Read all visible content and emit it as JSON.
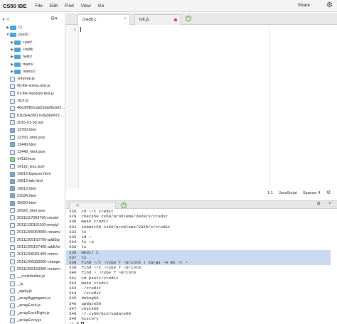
{
  "app": {
    "name": "CS50 IDE"
  },
  "menu": [
    "File",
    "Edit",
    "Find",
    "View",
    "Go"
  ],
  "share_label": "Share",
  "tree": {
    "root": "~/",
    "items": [
      {
        "label": "C/",
        "kind": "folder",
        "depth": 1,
        "caret": "▶"
      },
      {
        "label": "pset1/",
        "kind": "folder",
        "depth": 1,
        "caret": "▼"
      },
      {
        "label": "cash/",
        "kind": "folder",
        "depth": 2,
        "caret": "▶"
      },
      {
        "label": "credit/",
        "kind": "folder",
        "depth": 2,
        "caret": "▶"
      },
      {
        "label": "hello/",
        "kind": "folder",
        "depth": 2,
        "caret": "▶"
      },
      {
        "label": "mario/",
        "kind": "folder",
        "depth": 2,
        "caret": "▶"
      },
      {
        "label": "mario2/",
        "kind": "folder",
        "depth": 2,
        "caret": "▶"
      },
      {
        "label": "-internal.js",
        "kind": "file",
        "depth": 1,
        "caret": ""
      },
      {
        "label": "00-file-stress.test.js",
        "kind": "file",
        "depth": 1,
        "caret": ""
      },
      {
        "label": "01-file-maxsize.test.js",
        "kind": "file",
        "depth": 1,
        "caret": ""
      },
      {
        "label": "1to2.js",
        "kind": "file",
        "depth": 1,
        "caret": ""
      },
      {
        "label": "46e3f6f52cda23da06cb02…",
        "kind": "file",
        "depth": 1,
        "caret": ""
      },
      {
        "label": "61b3e429917e8a5b8472…",
        "kind": "file",
        "depth": 1,
        "caret": ""
      },
      {
        "label": "2015-01-30.md",
        "kind": "file",
        "depth": 1,
        "caret": ""
      },
      {
        "label": "12750.html",
        "kind": "img",
        "depth": 1,
        "caret": ""
      },
      {
        "label": "12750_html.json",
        "kind": "file",
        "depth": 1,
        "caret": ""
      },
      {
        "label": "13448.html",
        "kind": "img",
        "depth": 1,
        "caret": ""
      },
      {
        "label": "13448_html.json",
        "kind": "file",
        "depth": 1,
        "caret": ""
      },
      {
        "label": "14119.less",
        "kind": "less",
        "depth": 1,
        "caret": ""
      },
      {
        "label": "14119_less.json",
        "kind": "file",
        "depth": 1,
        "caret": ""
      },
      {
        "label": "19813-fspaces.html",
        "kind": "img",
        "depth": 1,
        "caret": ""
      },
      {
        "label": "19813-tab.html",
        "kind": "img",
        "depth": 1,
        "caret": ""
      },
      {
        "label": "19813.html",
        "kind": "img",
        "depth": 1,
        "caret": ""
      },
      {
        "label": "21634.html",
        "kind": "img",
        "depth": 1,
        "caret": ""
      },
      {
        "label": "25920.html",
        "kind": "img",
        "depth": 1,
        "caret": ""
      },
      {
        "label": "25920_html.json",
        "kind": "file",
        "depth": 1,
        "caret": ""
      },
      {
        "label": "20111117063700-createl",
        "kind": "file",
        "depth": 1,
        "caret": ""
      },
      {
        "label": "20111130161100-emptyf",
        "kind": "file",
        "depth": 1,
        "caret": ""
      },
      {
        "label": "20111205064000-renamv",
        "kind": "file",
        "depth": 1,
        "caret": ""
      },
      {
        "label": "20111205162700-addSig",
        "kind": "file",
        "depth": 1,
        "caret": ""
      },
      {
        "label": "20111205167400-addUni",
        "kind": "file",
        "depth": 1,
        "caret": ""
      },
      {
        "label": "20111206061400-remov",
        "kind": "file",
        "depth": 1,
        "caret": ""
      },
      {
        "label": "20111206063000-change",
        "kind": "file",
        "depth": 1,
        "caret": ""
      },
      {
        "label": "20111206163300-renamv",
        "kind": "file",
        "depth": 1,
        "caret": ""
      },
      {
        "label": "__contribution.js",
        "kind": "file",
        "depth": 1,
        "caret": ""
      },
      {
        "label": "_.js",
        "kind": "file",
        "depth": 1,
        "caret": ""
      },
      {
        "label": "_apply.js",
        "kind": "file",
        "depth": 1,
        "caret": ""
      },
      {
        "label": "_arrayAggregator.js",
        "kind": "file",
        "depth": 1,
        "caret": ""
      },
      {
        "label": "_arrayEach.js",
        "kind": "file",
        "depth": 1,
        "caret": ""
      },
      {
        "label": "_arrayEachRight.js",
        "kind": "file",
        "depth": 1,
        "caret": ""
      },
      {
        "label": "_arrayEvery.js",
        "kind": "file",
        "depth": 1,
        "caret": ""
      }
    ]
  },
  "editor": {
    "tabs": [
      {
        "label": "credit.c",
        "active": true,
        "modified": false
      },
      {
        "label": "init.js",
        "active": false,
        "modified": true
      }
    ],
    "line_number": "1"
  },
  "status": {
    "position": "1:1",
    "language": "JavaScript",
    "spaces": "Spaces: 4"
  },
  "terminal": {
    "tab_label": "~/",
    "lines": [
      {
        "num": "328",
        "cmd": "cd ~/C credit",
        "hl": false
      },
      {
        "num": "329",
        "cmd": "check50 cs50/problems/2020/x/credit",
        "hl": false
      },
      {
        "num": "330",
        "cmd": "make credit",
        "hl": false
      },
      {
        "num": "331",
        "cmd": "submit50 cs50/problems/2020/x/credit",
        "hl": false
      },
      {
        "num": "332",
        "cmd": "ls",
        "hl": false
      },
      {
        "num": "333",
        "cmd": "cd ~",
        "hl": false
      },
      {
        "num": "334",
        "cmd": "ls ~a",
        "hl": false
      },
      {
        "num": "335",
        "cmd": "ls",
        "hl": false
      },
      {
        "num": "336",
        "cmd": "mkdir C",
        "hl": true
      },
      {
        "num": "337",
        "cmd": "ls",
        "hl": true
      },
      {
        "num": "338",
        "cmd": "find ~/C ~type f ~print0 | xargs ~0 mv ~t ~",
        "hl": true
      },
      {
        "num": "339",
        "cmd": "find ~/C ~type f ~print0",
        "hl": false
      },
      {
        "num": "340",
        "cmd": "find ~ ~type f ~print0",
        "hl": false
      },
      {
        "num": "341",
        "cmd": "cd pset1/credit",
        "hl": false
      },
      {
        "num": "342",
        "cmd": "make credit",
        "hl": false
      },
      {
        "num": "343",
        "cmd": "./credit",
        "hl": false
      },
      {
        "num": "344",
        "cmd": "./credit",
        "hl": false
      },
      {
        "num": "345",
        "cmd": "debug50",
        "hl": false
      },
      {
        "num": "346",
        "cmd": "update50",
        "hl": false
      },
      {
        "num": "347",
        "cmd": "check50",
        "hl": false
      },
      {
        "num": "348",
        "cmd": "~/.cs50/bin/update50",
        "hl": false
      },
      {
        "num": "349",
        "cmd": "history",
        "hl": false
      }
    ],
    "prompt": "~/ $"
  },
  "colors": {
    "accent": "#4aa3d9",
    "highlight": "#c9d9ef",
    "add": "#5a9a4a"
  }
}
